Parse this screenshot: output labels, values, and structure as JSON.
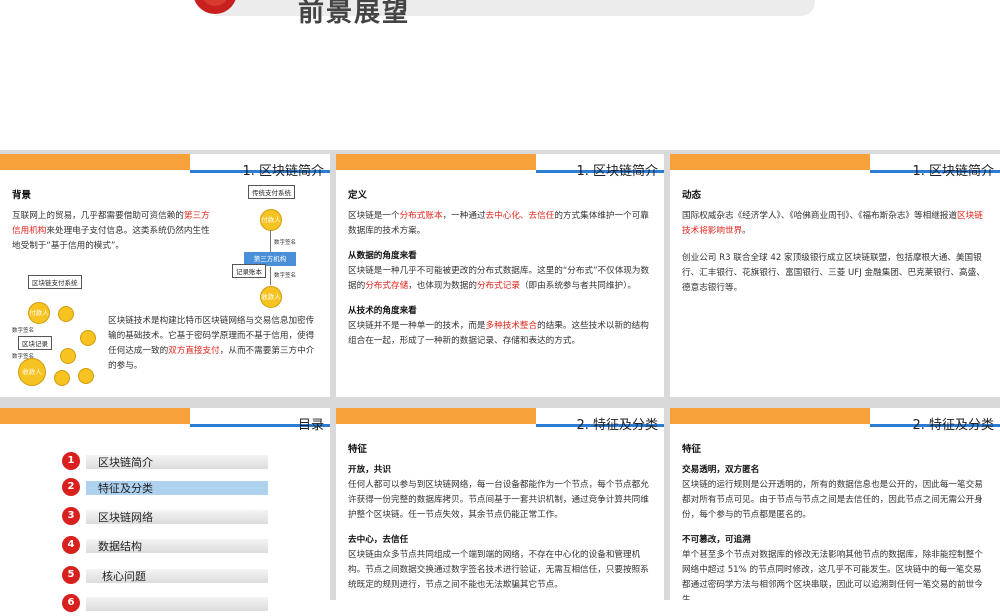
{
  "hero": {
    "title": "前景展望"
  },
  "slide1": {
    "header": "1. 区块链简介",
    "heading": "背景",
    "p1_a": "互联网上的贸易，几乎都需要借助可资信赖的",
    "p1_red": "第三方信用机构",
    "p1_b": "来处理电子支付信息。这类系统仍然内生性地受制于“基于信用的模式”。",
    "p2_a": "区块链技术是构建比特币区块链网络与交易信息加密传输的基础技术。它基于密码学原理而不基于信用，使得任何达成一致的",
    "p2_red": "双方直接支付",
    "p2_b": "，从而不需要第三方中介的参与。",
    "diagram1": {
      "title": "传统支付系统",
      "payer": "付款人",
      "payee": "收款人",
      "center": "第三方机构",
      "ledger": "记录账本",
      "sig1": "数字签名",
      "sig2": "数字签名"
    },
    "diagram2": {
      "title": "区块链支付系统",
      "payer": "付款人",
      "payee": "收款人",
      "sig1": "数字签名",
      "record": "区块记录",
      "sig2": "数字签名"
    }
  },
  "slide2": {
    "header": "1. 区块链简介",
    "heading": "定义",
    "def_a": "区块链是一个",
    "def_r1": "分布式账本",
    "def_b": "，一种通过",
    "def_r2": "去中心化、去信任",
    "def_c": "的方式集体维护一个可靠数据库的技术方案。",
    "sub1": "从数据的角度来看",
    "d_a": "区块链是一种几乎不可能被更改的分布式数据库。这里的“分布式”不仅体现为数据的",
    "d_r1": "分布式存储",
    "d_b": "，也体现为数据的",
    "d_r2": "分布式记录",
    "d_c": "（即由系统参与者共同维护）。",
    "sub2": "从技术的角度来看",
    "t_a": "区块链并不是一种单一的技术，而是",
    "t_r": "多种技术整合",
    "t_b": "的结果。这些技术以新的结构组合在一起，形成了一种新的数据记录、存储和表达的方式。"
  },
  "slide3": {
    "header": "1. 区块链简介",
    "heading": "动态",
    "p1_a": "国际权威杂志《经济学人》、《哈佛商业周刊》、《福布斯杂志》等相继报道",
    "p1_red": "区块链技术将影响世界",
    "p1_b": "。",
    "p2": "创业公司 R3 联合全球 42 家顶级银行成立区块链联盟，包括摩根大通、美国银行、汇丰银行、花旗银行、富国银行、三菱 UFJ 金融集团、巴克莱银行、高盛、德意志银行等。"
  },
  "slide4": {
    "header": "目录",
    "items": [
      {
        "num": "1",
        "label": "区块链简介"
      },
      {
        "num": "2",
        "label": "特征及分类"
      },
      {
        "num": "3",
        "label": "区块链网络"
      },
      {
        "num": "4",
        "label": "数据结构"
      },
      {
        "num": "5",
        "label": "核心问题"
      },
      {
        "num": "6",
        "label": ""
      }
    ]
  },
  "slide5": {
    "header": "2. 特征及分类",
    "heading": "特征",
    "sub1": "开放，共识",
    "p1": "任何人都可以参与到区块链网络，每一台设备都能作为一个节点，每个节点都允许获得一份完整的数据库拷贝。节点间基于一套共识机制，通过竞争计算共同维护整个区块链。任一节点失效，其余节点仍能正常工作。",
    "sub2": "去中心，去信任",
    "p2": "区块链由众多节点共同组成一个端到端的网络，不存在中心化的设备和管理机构。节点之间数据交换通过数字签名技术进行验证，无需互相信任，只要按照系统既定的规则进行，节点之间不能也无法欺骗其它节点。"
  },
  "slide6": {
    "header": "2. 特征及分类",
    "heading": "特征",
    "sub1": "交易透明，双方匿名",
    "p1": "区块链的运行规则是公开透明的，所有的数据信息也是公开的，因此每一笔交易都对所有节点可见。由于节点与节点之间是去信任的，因此节点之间无需公开身份，每个参与的节点都是匿名的。",
    "sub2": "不可篡改，可追溯",
    "p2": "单个甚至多个节点对数据库的修改无法影响其他节点的数据库，除非能控制整个网络中超过 51% 的节点同时修改，这几乎不可能发生。区块链中的每一笔交易都通过密码学方法与相邻两个区块串联，因此可以追溯到任何一笔交易的前世今生。"
  },
  "colors": {
    "accent_orange": "#f6a13a",
    "accent_blue": "#2a7cd5",
    "highlight_red": "#e0261b",
    "toc_red": "#d8201e"
  }
}
